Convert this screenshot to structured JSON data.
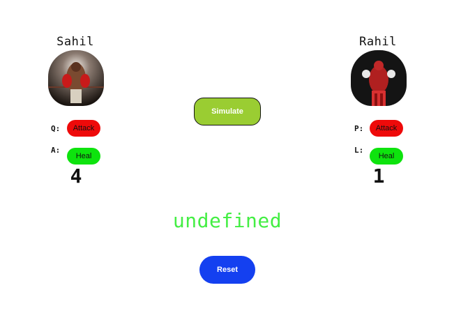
{
  "player1": {
    "name": "Sahil",
    "attack_key": "Q:",
    "heal_key": "A:",
    "attack_label": "Attack",
    "heal_label": "Heal",
    "score": "4"
  },
  "player2": {
    "name": "Rahil",
    "attack_key": "P:",
    "heal_key": "L:",
    "attack_label": "Attack",
    "heal_label": "Heal",
    "score": "1"
  },
  "simulate_label": "Simulate",
  "result_text": "undefined",
  "reset_label": "Reset",
  "colors": {
    "attack": "#ee0a0a",
    "heal": "#0ee30e",
    "simulate": "#9acd32",
    "reset": "#1440f0",
    "result_text": "#44ee44"
  }
}
